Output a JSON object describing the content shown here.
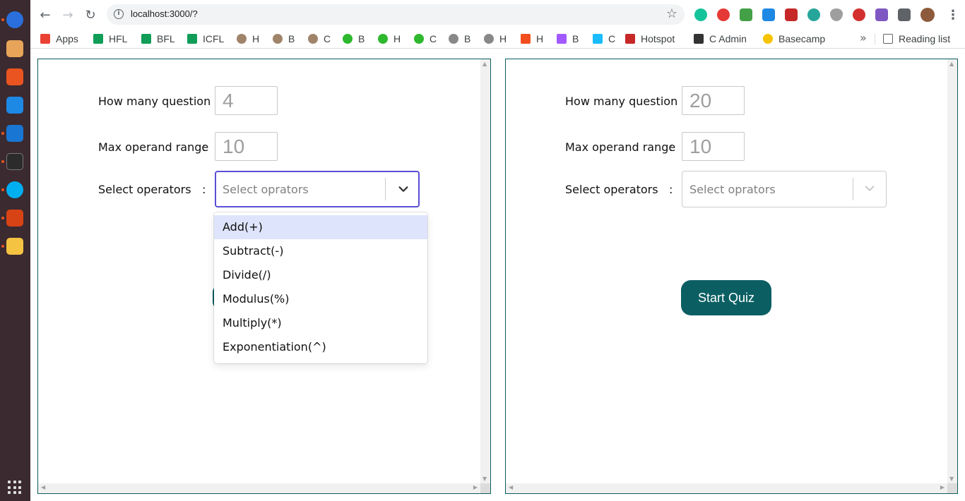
{
  "browser": {
    "url": "localhost:3000/?"
  },
  "bookmarks": [
    {
      "label": "Apps",
      "color": "#e94235"
    },
    {
      "label": "HFL",
      "color": "#0f9d58"
    },
    {
      "label": "BFL",
      "color": "#0f9d58"
    },
    {
      "label": "ICFL",
      "color": "#0f9d58"
    },
    {
      "label": "H",
      "color": "#a0846a"
    },
    {
      "label": "B",
      "color": "#a0846a"
    },
    {
      "label": "C",
      "color": "#a0846a"
    },
    {
      "label": "B",
      "color": "#2eb82e"
    },
    {
      "label": "H",
      "color": "#2eb82e"
    },
    {
      "label": "C",
      "color": "#2eb82e"
    },
    {
      "label": "B",
      "color": "#888888"
    },
    {
      "label": "H",
      "color": "#888888"
    },
    {
      "label": "H",
      "color": "#f24e1e"
    },
    {
      "label": "B",
      "color": "#a259ff"
    },
    {
      "label": "C",
      "color": "#1abcfe"
    },
    {
      "label": "Hotspot",
      "color": "#c62828"
    },
    {
      "label": "C Admin",
      "color": "#333333"
    },
    {
      "label": "Basecamp",
      "color": "#f7c300"
    }
  ],
  "reading_list": "Reading list",
  "left_panel": {
    "questions_label": "How many question :",
    "questions_value": "4",
    "range_label": "Max operand range",
    "range_colon": ":",
    "range_value": "10",
    "operators_label": "Select operators",
    "operators_colon": ":",
    "operators_placeholder": "Select oprators",
    "options": [
      "Add(+)",
      "Subtract(-)",
      "Divide(/)",
      "Modulus(%)",
      "Multiply(*)",
      "Exponentiation(^)"
    ]
  },
  "right_panel": {
    "questions_label": "How many question :",
    "questions_value": "20",
    "range_label": "Max operand range",
    "range_colon": ":",
    "range_value": "10",
    "operators_label": "Select operators",
    "operators_colon": ":",
    "operators_placeholder": "Select oprators",
    "start_label": "Start Quiz"
  },
  "colors": {
    "accent": "#0b5f63",
    "focus": "#5b4fd6",
    "option_highlight": "#dee4fb"
  }
}
